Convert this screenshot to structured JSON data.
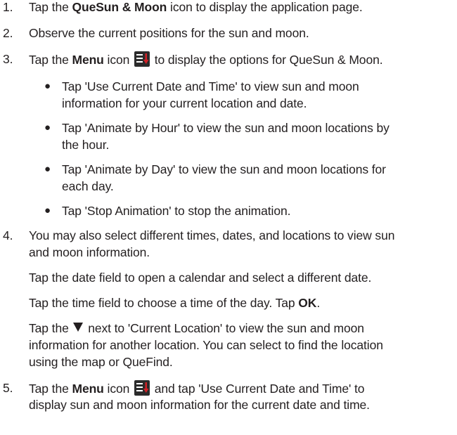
{
  "steps": {
    "s1": {
      "num": "1.",
      "pre": "Tap the ",
      "bold": "QueSun & Moon",
      "post": " icon to display the application page."
    },
    "s2": {
      "num": "2.",
      "text": "Observe the current positions for the sun and moon."
    },
    "s3": {
      "num": "3.",
      "pre": "Tap the ",
      "bold": "Menu",
      "mid": " icon ",
      "post": " to display the options for QueSun & Moon."
    },
    "bullets": [
      {
        "l1": "Tap 'Use Current Date and Time' to view sun and moon",
        "l2": "information for your current location and date."
      },
      {
        "l1": "Tap 'Animate by Hour' to view the sun and moon locations by",
        "l2": "the hour."
      },
      {
        "l1": "Tap 'Animate by Day' to view the sun and moon locations for",
        "l2": "each day."
      },
      {
        "l1": "Tap 'Stop Animation' to stop the animation."
      }
    ],
    "s4": {
      "num": "4.",
      "l1": "You may also select different times, dates, and locations to view sun",
      "l2": "and moon information.",
      "p1": "Tap the date field to open a calendar and select a different date.",
      "p2_pre": "Tap the time field to choose a time of the day.  Tap ",
      "p2_bold": "OK",
      "p2_post": ".",
      "p3_pre": "Tap the ",
      "p3_post": " next to 'Current Location' to view the sun and moon",
      "p3_l2": "information for another location.  You can select to find the location",
      "p3_l3": "using the map or QueFind."
    },
    "s5": {
      "num": "5.",
      "pre": "Tap the ",
      "bold": "Menu",
      "mid": " icon ",
      "post": " and tap 'Use Current Date and Time' to",
      "l2": "display sun and moon information for the current date and time."
    }
  },
  "icons": {
    "menu": "menu-list-icon",
    "triangle": "down-triangle-icon"
  },
  "colors": {
    "text": "#231f20",
    "icon_bg": "#2b2b2b",
    "icon_arrow": "#d32027"
  }
}
